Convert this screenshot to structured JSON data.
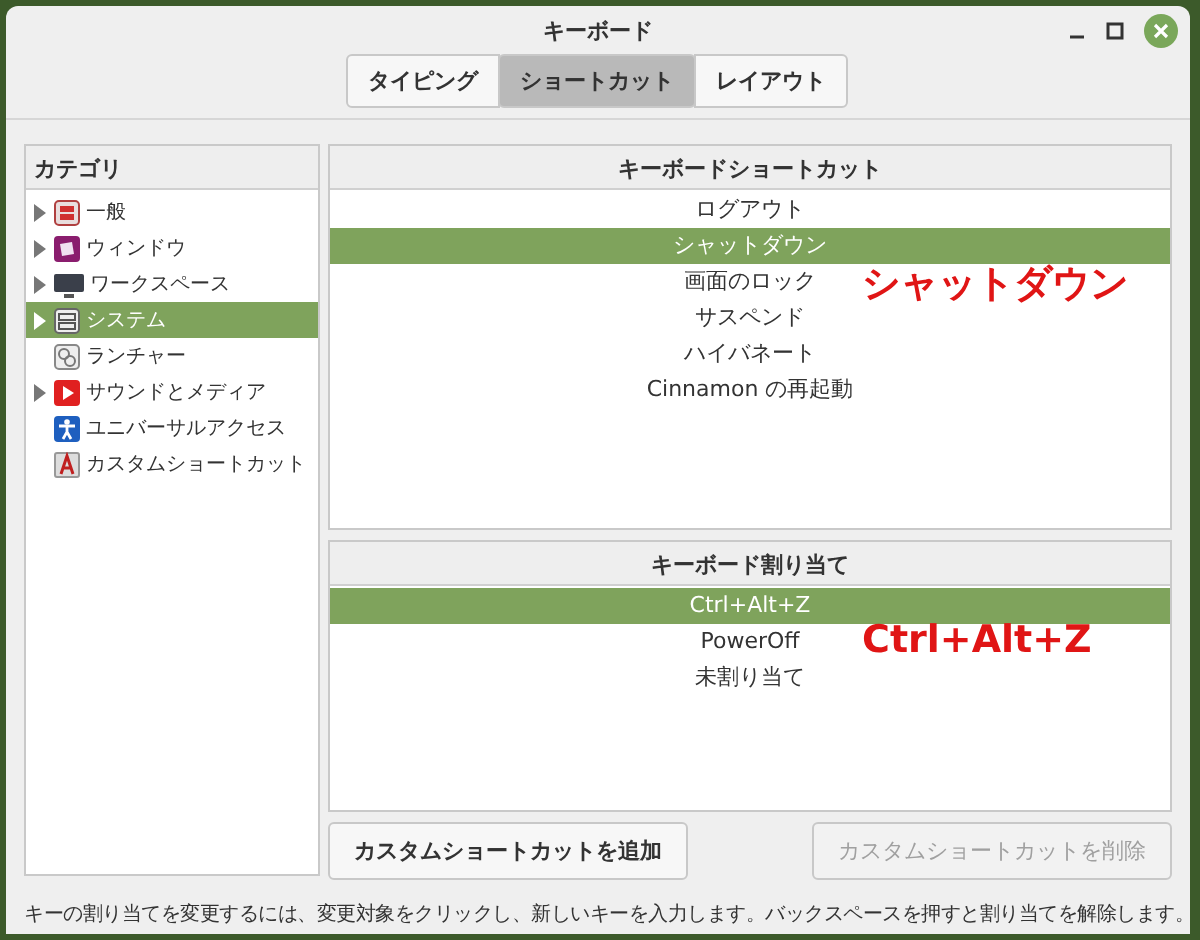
{
  "window": {
    "title": "キーボード"
  },
  "tabs": [
    {
      "label": "タイピング",
      "selected": false
    },
    {
      "label": "ショートカット",
      "selected": true
    },
    {
      "label": "レイアウト",
      "selected": false
    }
  ],
  "categories": {
    "heading": "カテゴリ",
    "items": [
      {
        "label": "一般",
        "expandable": true,
        "selected": false
      },
      {
        "label": "ウィンドウ",
        "expandable": true,
        "selected": false
      },
      {
        "label": "ワークスペース",
        "expandable": true,
        "selected": false
      },
      {
        "label": "システム",
        "expandable": true,
        "selected": true
      },
      {
        "label": "ランチャー",
        "expandable": false,
        "selected": false
      },
      {
        "label": "サウンドとメディア",
        "expandable": true,
        "selected": false
      },
      {
        "label": "ユニバーサルアクセス",
        "expandable": false,
        "selected": false
      },
      {
        "label": "カスタムショートカット",
        "expandable": false,
        "selected": false
      }
    ]
  },
  "shortcuts": {
    "heading": "キーボードショートカット",
    "rows": [
      {
        "label": "ログアウト",
        "selected": false
      },
      {
        "label": "シャットダウン",
        "selected": true
      },
      {
        "label": "画面のロック",
        "selected": false
      },
      {
        "label": "サスペンド",
        "selected": false
      },
      {
        "label": "ハイバネート",
        "selected": false
      },
      {
        "label": "Cinnamon の再起動",
        "selected": false
      }
    ],
    "annotation": "シャットダウン"
  },
  "bindings": {
    "heading": "キーボード割り当て",
    "rows": [
      {
        "label": "Ctrl+Alt+Z",
        "selected": true
      },
      {
        "label": "PowerOff",
        "selected": false
      },
      {
        "label": "未割り当て",
        "selected": false
      }
    ],
    "annotation": "Ctrl+Alt+Z"
  },
  "buttons": [
    {
      "label": "カスタムショートカットを追加",
      "disabled": false
    },
    {
      "label": "カスタムショートカットを削除",
      "disabled": true
    }
  ],
  "status_bar": "キーの割り当てを変更するには、変更対象をクリックし、新しいキーを入力します。バックスペースを押すと割り当てを解除します。"
}
